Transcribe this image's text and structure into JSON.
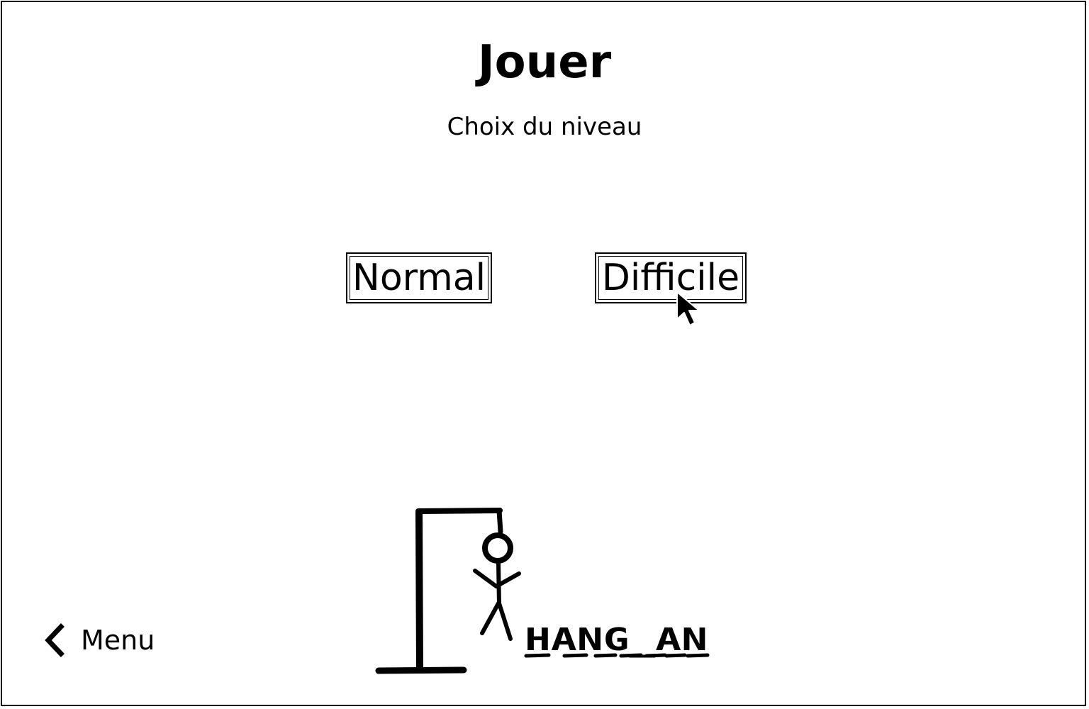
{
  "page": {
    "title": "Jouer",
    "subtitle": "Choix du niveau"
  },
  "levels": {
    "normal_label": "Normal",
    "difficile_label": "Difficile"
  },
  "nav": {
    "back_icon": "chevron-left-icon",
    "back_label": "Menu"
  },
  "logo": {
    "word": "HANG_AN",
    "graphic": "hangman-gallows"
  },
  "colors": {
    "ink": "#000000",
    "background": "#ffffff"
  }
}
